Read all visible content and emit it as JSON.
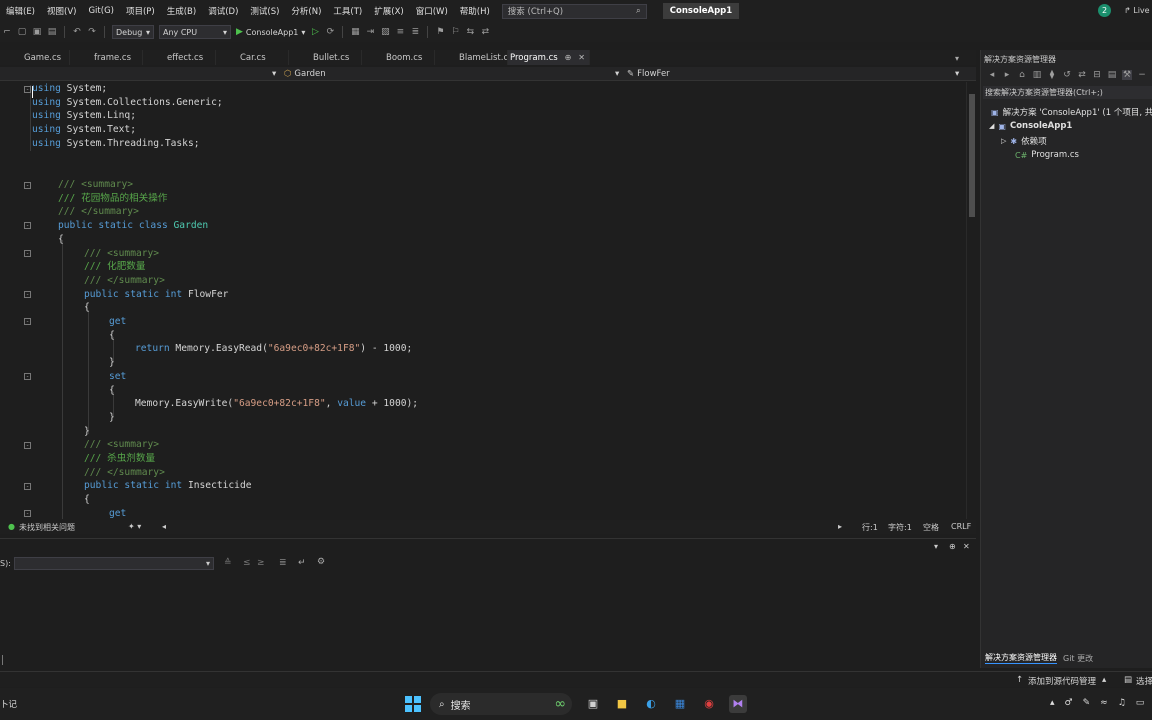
{
  "menu": [
    "编辑(E)",
    "视图(V)",
    "Git(G)",
    "项目(P)",
    "生成(B)",
    "调试(D)",
    "测试(S)",
    "分析(N)",
    "工具(T)",
    "扩展(X)",
    "窗口(W)",
    "帮助(H)"
  ],
  "search": {
    "label": "搜索 (Ctrl+Q)",
    "icon": "search-icon"
  },
  "app_title": "ConsoleApp1",
  "notification_count": "2",
  "live_share": "Live",
  "toolbar": {
    "config": "Debug",
    "platform": "Any CPU",
    "start_label": "ConsoleApp1"
  },
  "tabs": [
    "Game.cs",
    "frame.cs",
    "effect.cs",
    "Car.cs",
    "Bullet.cs",
    "Boom.cs",
    "BlameList.cs"
  ],
  "active_tab": "Program.cs",
  "nav": {
    "class_combo": "Garden",
    "member_combo": "FlowFer"
  },
  "code": {
    "l1_kw": "using",
    "l1_rest": " System;",
    "l2_kw": "using",
    "l2_rest": " System.Collections.Generic;",
    "l3_kw": "using",
    "l3_rest": " System.Linq;",
    "l4_kw": "using",
    "l4_rest": " System.Text;",
    "l5_kw": "using",
    "l5_rest": " System.Threading.Tasks;",
    "sum_open": "/// <summary>",
    "sum_close": "/// </summary>",
    "garden_doc": "/// 花园物品的相关操作",
    "public_static_class": "public static class",
    "garden_name": " Garden",
    "open_brace": "{",
    "close_brace": "}",
    "flowfer_doc": "/// 化肥数量",
    "public_static_int": "public static int",
    "flowfer_name": " FlowFer",
    "get": "get",
    "set": "set",
    "return_kw": "return",
    "read_call": " Memory.EasyRead(",
    "read_str": "\"6a9ec0+82c+1F8\"",
    "read_tail": ") - 1000;",
    "write_call": "Memory.EasyWrite(",
    "write_str": "\"6a9ec0+82c+1F8\"",
    "write_mid": ", ",
    "value_kw": "value",
    "write_tail": " + 1000);",
    "insect_doc": "/// 杀虫剂数量",
    "insect_name": " Insecticide"
  },
  "editor_status": {
    "issues": "未找到相关问题",
    "line": "行:1",
    "char": "字符:1",
    "mode": "空格",
    "eol": "CRLF"
  },
  "output": {
    "label": "S):"
  },
  "solution": {
    "title": "解决方案资源管理器",
    "search": "搜索解决方案资源管理器(Ctrl+;)",
    "solution_node": "解决方案 'ConsoleApp1' (1 个项目, 共",
    "project_node": "ConsoleApp1",
    "deps_node": "依赖项",
    "file_node": "Program.cs",
    "tab_active": "解决方案资源管理器",
    "tab_git": "Git 更改"
  },
  "statusbar": {
    "add_source": "添加到源代码管理",
    "repo": "选择仓库",
    "left": "卜记"
  },
  "taskbar": {
    "search": "搜索",
    "left_text": "卜记"
  },
  "colors": {
    "keyword": "#569cd6",
    "type": "#4ec9b0",
    "comment": "#57a64a",
    "string": "#d69d85",
    "accent": "#3794ff"
  }
}
